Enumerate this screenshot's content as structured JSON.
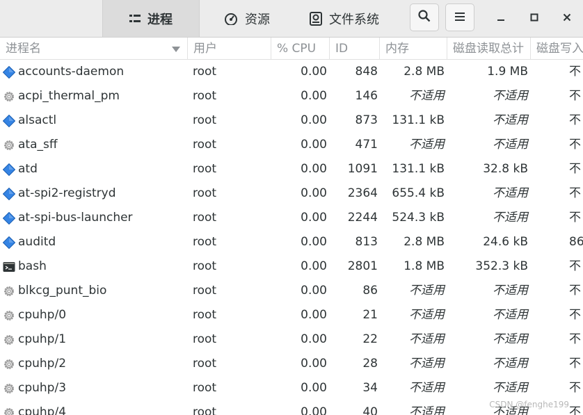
{
  "tabs": [
    {
      "label": "进程",
      "icon": "list-icon",
      "active": true
    },
    {
      "label": "资源",
      "icon": "speedometer-icon",
      "active": false
    },
    {
      "label": "文件系统",
      "icon": "disk-icon",
      "active": false
    }
  ],
  "header_buttons": {
    "search": "search-icon",
    "menu": "hamburger-menu-icon"
  },
  "window_controls": {
    "minimize": "–",
    "maximize": "▫",
    "close": "×"
  },
  "columns": {
    "name": "进程名",
    "user": "用户",
    "cpu": "% CPU",
    "id": "ID",
    "memory": "内存",
    "disk_read_total": "磁盘读取总计",
    "disk_write_total": "磁盘写入"
  },
  "processes": [
    {
      "name": "accounts-daemon",
      "icon": "diamond-app-icon",
      "user": "root",
      "cpu": "0.00",
      "id": "848",
      "memory": "2.8 MB",
      "disk_read": "1.9 MB",
      "disk_write": "不"
    },
    {
      "name": "acpi_thermal_pm",
      "icon": "gear-icon",
      "user": "root",
      "cpu": "0.00",
      "id": "146",
      "memory": "不适用",
      "disk_read": "不适用",
      "disk_write": "不"
    },
    {
      "name": "alsactl",
      "icon": "diamond-app-icon",
      "user": "root",
      "cpu": "0.00",
      "id": "873",
      "memory": "131.1 kB",
      "disk_read": "不适用",
      "disk_write": "不"
    },
    {
      "name": "ata_sff",
      "icon": "gear-icon",
      "user": "root",
      "cpu": "0.00",
      "id": "471",
      "memory": "不适用",
      "disk_read": "不适用",
      "disk_write": "不"
    },
    {
      "name": "atd",
      "icon": "diamond-app-icon",
      "user": "root",
      "cpu": "0.00",
      "id": "1091",
      "memory": "131.1 kB",
      "disk_read": "32.8 kB",
      "disk_write": "不"
    },
    {
      "name": "at-spi2-registryd",
      "icon": "diamond-app-icon",
      "user": "root",
      "cpu": "0.00",
      "id": "2364",
      "memory": "655.4 kB",
      "disk_read": "不适用",
      "disk_write": "不"
    },
    {
      "name": "at-spi-bus-launcher",
      "icon": "diamond-app-icon",
      "user": "root",
      "cpu": "0.00",
      "id": "2244",
      "memory": "524.3 kB",
      "disk_read": "不适用",
      "disk_write": "不"
    },
    {
      "name": "auditd",
      "icon": "diamond-app-icon",
      "user": "root",
      "cpu": "0.00",
      "id": "813",
      "memory": "2.8 MB",
      "disk_read": "24.6 kB",
      "disk_write": "86"
    },
    {
      "name": "bash",
      "icon": "terminal-icon",
      "user": "root",
      "cpu": "0.00",
      "id": "2801",
      "memory": "1.8 MB",
      "disk_read": "352.3 kB",
      "disk_write": "不"
    },
    {
      "name": "blkcg_punt_bio",
      "icon": "gear-icon",
      "user": "root",
      "cpu": "0.00",
      "id": "86",
      "memory": "不适用",
      "disk_read": "不适用",
      "disk_write": "不"
    },
    {
      "name": "cpuhp/0",
      "icon": "gear-icon",
      "user": "root",
      "cpu": "0.00",
      "id": "21",
      "memory": "不适用",
      "disk_read": "不适用",
      "disk_write": "不"
    },
    {
      "name": "cpuhp/1",
      "icon": "gear-icon",
      "user": "root",
      "cpu": "0.00",
      "id": "22",
      "memory": "不适用",
      "disk_read": "不适用",
      "disk_write": "不"
    },
    {
      "name": "cpuhp/2",
      "icon": "gear-icon",
      "user": "root",
      "cpu": "0.00",
      "id": "28",
      "memory": "不适用",
      "disk_read": "不适用",
      "disk_write": "不"
    },
    {
      "name": "cpuhp/3",
      "icon": "gear-icon",
      "user": "root",
      "cpu": "0.00",
      "id": "34",
      "memory": "不适用",
      "disk_read": "不适用",
      "disk_write": "不"
    },
    {
      "name": "cpuhp/4",
      "icon": "gear-icon",
      "user": "root",
      "cpu": "0.00",
      "id": "40",
      "memory": "不适用",
      "disk_read": "不适用",
      "disk_write": "不"
    }
  ],
  "watermark": "CSDN @fenghe199"
}
